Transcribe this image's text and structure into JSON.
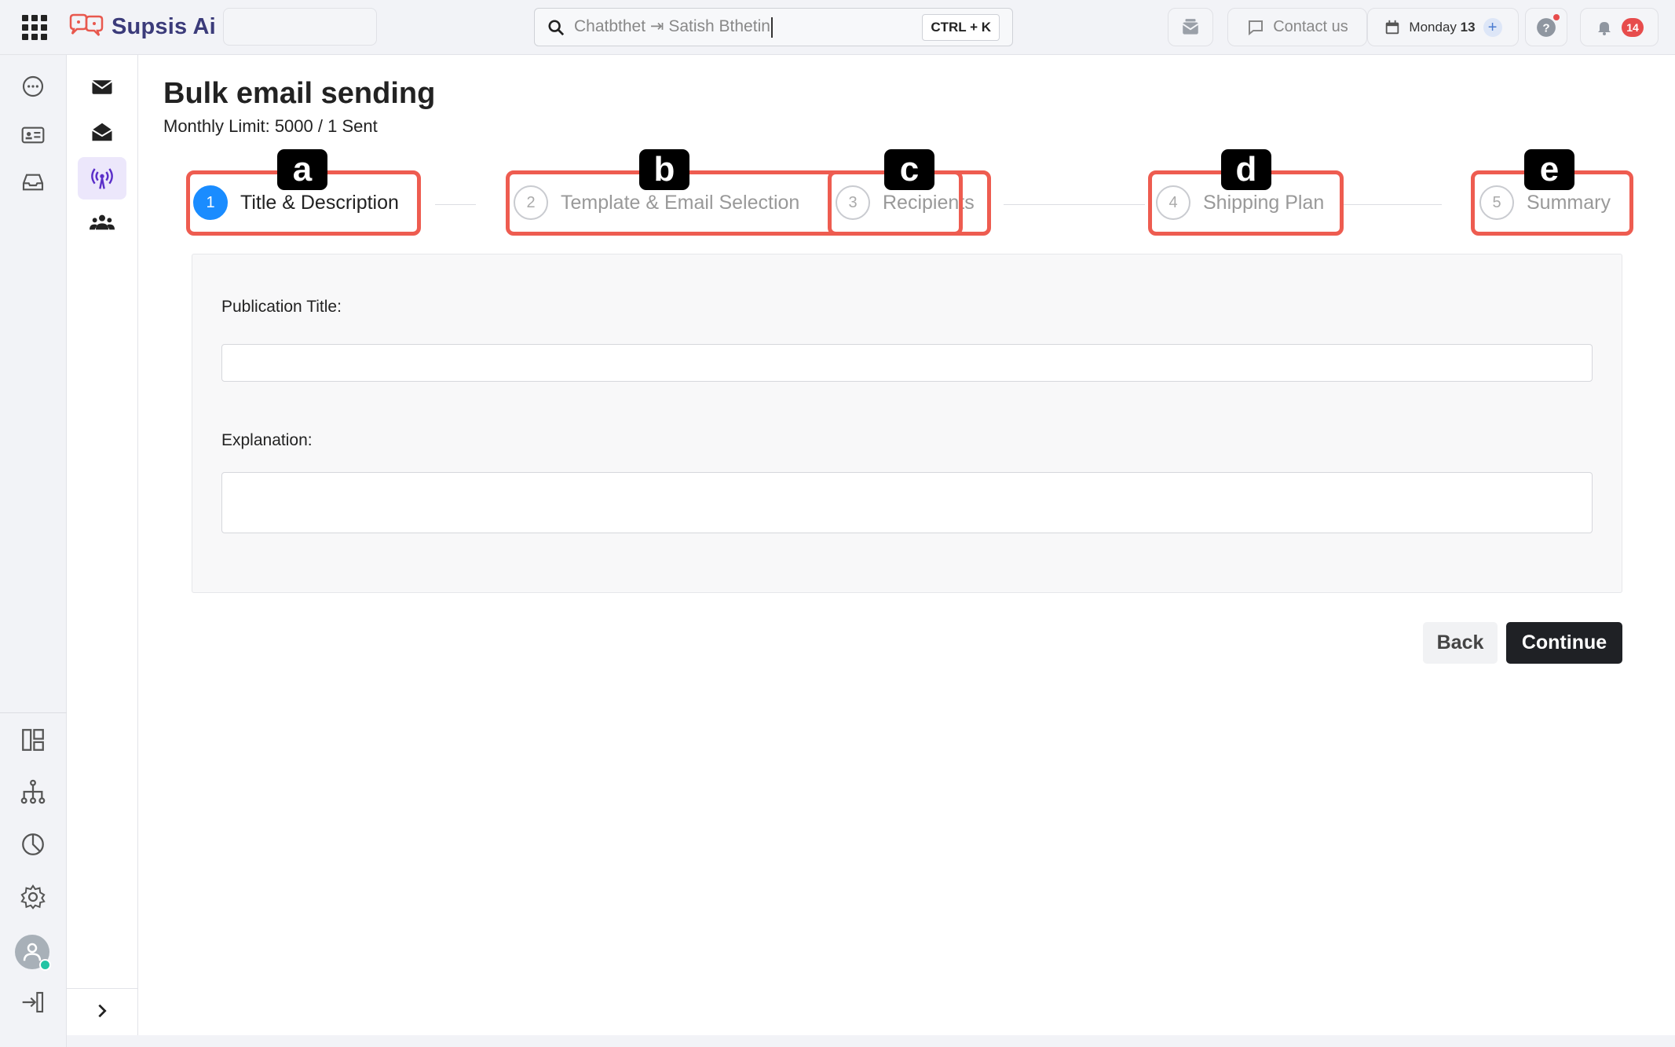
{
  "brand": {
    "name": "Supsis Ai",
    "accent": "#3b3b7a"
  },
  "search": {
    "value": "Chatbthet ⇥ Satish Bthetin",
    "shortcut": "CTRL + K"
  },
  "topbar": {
    "contact_label": "Contact us",
    "date_day": "Monday",
    "date_num": "13",
    "notification_count": "14"
  },
  "page": {
    "title": "Bulk email sending",
    "subtitle": "Monthly Limit: 5000 / 1 Sent"
  },
  "steps": [
    {
      "number": "1",
      "label": "Title & Description",
      "tag": "a",
      "active": true
    },
    {
      "number": "2",
      "label": "Template & Email Selection",
      "tag": "b",
      "active": false
    },
    {
      "number": "3",
      "label": "Recipients",
      "tag": "c",
      "active": false
    },
    {
      "number": "4",
      "label": "Shipping Plan",
      "tag": "d",
      "active": false
    },
    {
      "number": "5",
      "label": "Summary",
      "tag": "e",
      "active": false
    }
  ],
  "form": {
    "title_label": "Publication Title:",
    "title_value": "",
    "explanation_label": "Explanation:",
    "explanation_value": ""
  },
  "actions": {
    "back_label": "Back",
    "continue_label": "Continue"
  },
  "colors": {
    "step_active": "#1a8cff",
    "highlight": "#ee5c50",
    "badge": "#e74c4c"
  }
}
